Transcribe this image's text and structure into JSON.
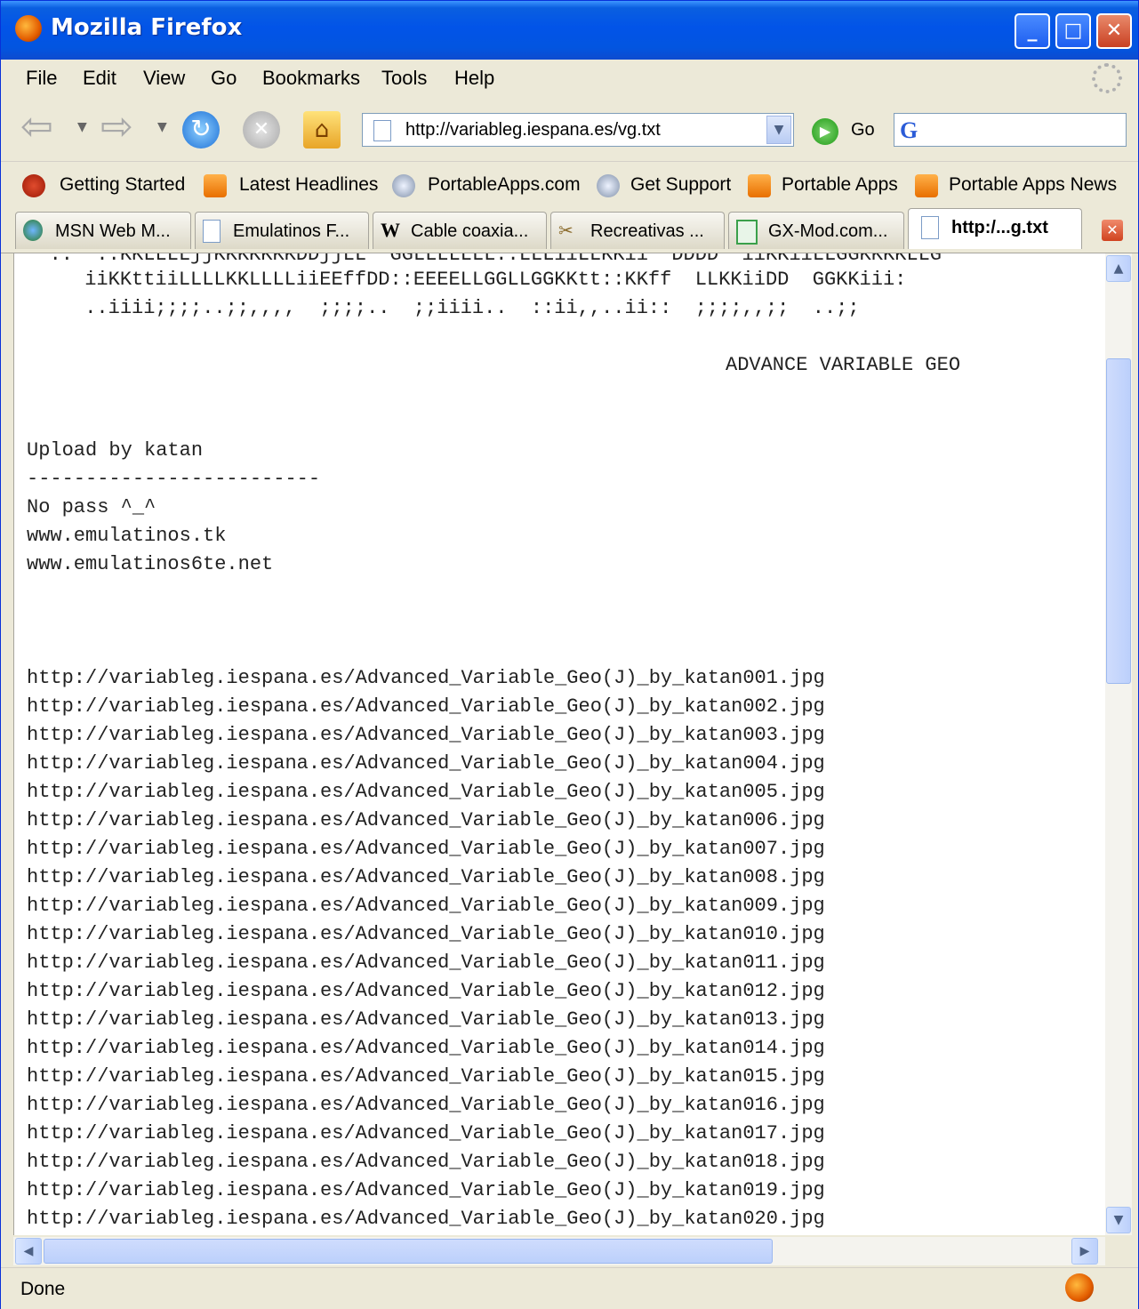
{
  "window": {
    "title": "Mozilla Firefox"
  },
  "menu": {
    "file": "File",
    "edit": "Edit",
    "view": "View",
    "go": "Go",
    "bookmarks": "Bookmarks",
    "tools": "Tools",
    "help": "Help"
  },
  "nav": {
    "url": "http://variableg.iespana.es/vg.txt",
    "go_label": "Go",
    "search_value": ""
  },
  "bookmarks": [
    {
      "label": "Getting Started",
      "icon": "getting-started-icon"
    },
    {
      "label": "Latest Headlines",
      "icon": "rss-icon"
    },
    {
      "label": "PortableApps.com",
      "icon": "portableapps-icon"
    },
    {
      "label": "Get Support",
      "icon": "portableapps-icon"
    },
    {
      "label": "Portable Apps",
      "icon": "rss-icon"
    },
    {
      "label": "Portable Apps News",
      "icon": "rss-icon"
    }
  ],
  "tabs": [
    {
      "label": "MSN Web M...",
      "icon": "msn-icon"
    },
    {
      "label": "Emulatinos F...",
      "icon": "document-icon"
    },
    {
      "label": "Cable coaxia...",
      "icon": "wikipedia-icon"
    },
    {
      "label": "Recreativas ...",
      "icon": "tools-icon"
    },
    {
      "label": "GX-Mod.com...",
      "icon": "gxmod-icon"
    },
    {
      "label": "http:/...g.txt",
      "icon": "document-icon",
      "active": true
    }
  ],
  "content": {
    "ascii_line_1": "   ::  ::KKLLLLjjKKKKKKKDDjjLL  GGLLLLLLL::LLLiiLLKKii  DDDD  iiKKiiLLGGKKKKLLG",
    "ascii_line_2": "      iiKKttiiLLLLKKLLLLiiEEffDD::EEEELLGGLLGGKKtt::KKff  LLKKiiDD  GGKKiii:",
    "ascii_line_3": "      ..iiii;;;;..;;,,,,  ;;;;..  ;;iiii..  ::ii,,..ii::  ;;;;,,;;  ..;;",
    "heading": "ADVANCE VARIABLE GEO",
    "upload": "Upload by katan",
    "separator": "-------------------------",
    "no_pass": "No pass ^_^",
    "site1": "www.emulatinos.tk",
    "site2": "www.emulatinos6te.net",
    "links": [
      "http://variableg.iespana.es/Advanced_Variable_Geo(J)_by_katan001.jpg",
      "http://variableg.iespana.es/Advanced_Variable_Geo(J)_by_katan002.jpg",
      "http://variableg.iespana.es/Advanced_Variable_Geo(J)_by_katan003.jpg",
      "http://variableg.iespana.es/Advanced_Variable_Geo(J)_by_katan004.jpg",
      "http://variableg.iespana.es/Advanced_Variable_Geo(J)_by_katan005.jpg",
      "http://variableg.iespana.es/Advanced_Variable_Geo(J)_by_katan006.jpg",
      "http://variableg.iespana.es/Advanced_Variable_Geo(J)_by_katan007.jpg",
      "http://variableg.iespana.es/Advanced_Variable_Geo(J)_by_katan008.jpg",
      "http://variableg.iespana.es/Advanced_Variable_Geo(J)_by_katan009.jpg",
      "http://variableg.iespana.es/Advanced_Variable_Geo(J)_by_katan010.jpg",
      "http://variableg.iespana.es/Advanced_Variable_Geo(J)_by_katan011.jpg",
      "http://variableg.iespana.es/Advanced_Variable_Geo(J)_by_katan012.jpg",
      "http://variableg.iespana.es/Advanced_Variable_Geo(J)_by_katan013.jpg",
      "http://variableg.iespana.es/Advanced_Variable_Geo(J)_by_katan014.jpg",
      "http://variableg.iespana.es/Advanced_Variable_Geo(J)_by_katan015.jpg",
      "http://variableg.iespana.es/Advanced_Variable_Geo(J)_by_katan016.jpg",
      "http://variableg.iespana.es/Advanced_Variable_Geo(J)_by_katan017.jpg",
      "http://variableg.iespana.es/Advanced_Variable_Geo(J)_by_katan018.jpg",
      "http://variableg.iespana.es/Advanced_Variable_Geo(J)_by_katan019.jpg",
      "http://variableg.iespana.es/Advanced_Variable_Geo(J)_by_katan020.jpg"
    ]
  },
  "status": {
    "text": "Done"
  },
  "icons": {
    "back": "back-arrow-icon",
    "forward": "forward-arrow-icon",
    "reload": "reload-icon",
    "stop": "stop-icon",
    "home": "home-icon",
    "go": "go-icon",
    "search_engine": "google-icon"
  }
}
